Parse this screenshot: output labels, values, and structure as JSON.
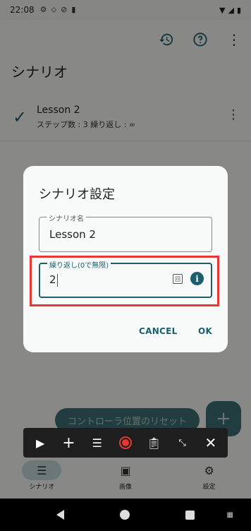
{
  "status_bar": {
    "time": "22:08",
    "left_icons": [
      "gear-icon",
      "location-icon",
      "no-disturb-icon",
      "sd-card-icon"
    ],
    "right_icons": [
      "wifi-icon",
      "signal-icon",
      "battery-icon"
    ]
  },
  "app_bar": {
    "title": "シナリオ",
    "actions": [
      "history-icon",
      "help-icon",
      "more-vert-icon"
    ]
  },
  "scenario": {
    "name": "Lesson 2",
    "meta": "ステップ数 : 3  繰り返し : ∞"
  },
  "dialog": {
    "title": "シナリオ設定",
    "name_field": {
      "label": "シナリオ名",
      "value": "Lesson 2"
    },
    "repeat_field": {
      "label": "繰り返し(0で無限)",
      "value": "2"
    },
    "cancel_label": "CANCEL",
    "ok_label": "OK"
  },
  "reset_button": "コントローラ位置のリセット",
  "fab": "+",
  "overlay_toolbar": [
    "play-icon",
    "add-icon",
    "list-icon",
    "record-icon",
    "clipboard-icon",
    "minimize-icon",
    "close-icon"
  ],
  "bottom_nav": [
    {
      "label": "シナリオ",
      "icon": "list-icon",
      "active": true
    },
    {
      "label": "画像",
      "icon": "image-icon",
      "active": false
    },
    {
      "label": "設定",
      "icon": "gear-icon",
      "active": false
    }
  ],
  "colors": {
    "accent": "#1c5f6b",
    "highlight": "#e53935",
    "record": "#e53935"
  }
}
